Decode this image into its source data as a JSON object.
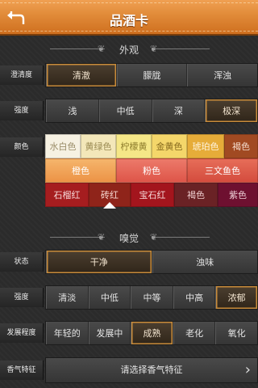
{
  "header": {
    "title": "品酒卡"
  },
  "sections": {
    "appearance": "外观",
    "nose": "嗅觉"
  },
  "appearance": {
    "clarity": {
      "label": "澄清度",
      "options": [
        "清澈",
        "朦胧",
        "浑浊"
      ],
      "selected": 0
    },
    "intensity": {
      "label": "强度",
      "options": [
        "浅",
        "中低",
        "深",
        "极深"
      ],
      "selected": 3
    },
    "color": {
      "label": "颜色",
      "row1": [
        "水白色",
        "黄绿色",
        "柠檬黄",
        "金黄色",
        "琥珀色",
        "褐色"
      ],
      "row2": [
        "橙色",
        "粉色",
        "三文鱼色"
      ],
      "row3": [
        "石榴红",
        "砖红",
        "宝石红",
        "褐色",
        "紫色"
      ],
      "selected": "砖红",
      "colors": {
        "row1": [
          "#f6f1e2",
          "#f3e7b9",
          "#f5e787",
          "#f4d66a",
          "#e6ac39",
          "#a14a22"
        ],
        "row2": [
          "#f2a65c",
          "#e76a5b",
          "#e0604f"
        ],
        "row3": [
          "#a51d1f",
          "#8f241a",
          "#a3151d",
          "#6a2225",
          "#6e1030"
        ]
      }
    }
  },
  "nose": {
    "condition": {
      "label": "状态",
      "options": [
        "干净",
        "浊味"
      ],
      "selected": 0
    },
    "intensity": {
      "label": "强度",
      "options": [
        "清淡",
        "中低",
        "中等",
        "中高",
        "浓郁"
      ],
      "selected": 4
    },
    "development": {
      "label": "发展程度",
      "options": [
        "年轻的",
        "发展中",
        "成熟",
        "老化",
        "氧化"
      ],
      "selected": 2
    },
    "aroma": {
      "label": "香气特征",
      "button": "请选择香气特征"
    }
  }
}
